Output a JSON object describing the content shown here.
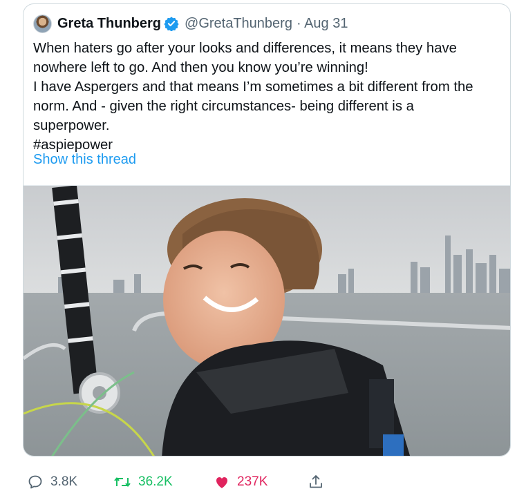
{
  "tweet": {
    "author_name": "Greta Thunberg",
    "handle": "@GretaThunberg",
    "date": "· Aug 31",
    "text": "When haters go after your looks and differences, it means they have\nnowhere left to go. And then you know you’re winning!\nI have Aspergers and that means I’m sometimes a bit different from the\nnorm. And - given the right circumstances- being different is a\nsuperpower.\n#aspiepower",
    "thread_link": "Show this thread"
  },
  "actions": {
    "replies": "3.8K",
    "retweets": "36.2K",
    "likes": "237K"
  },
  "colors": {
    "link": "#1d9bf0",
    "retweet": "#17bf63",
    "like": "#e0245e",
    "muted": "#536471"
  },
  "icons": [
    "verified-badge-icon",
    "reply-icon",
    "retweet-icon",
    "like-icon",
    "share-icon"
  ]
}
